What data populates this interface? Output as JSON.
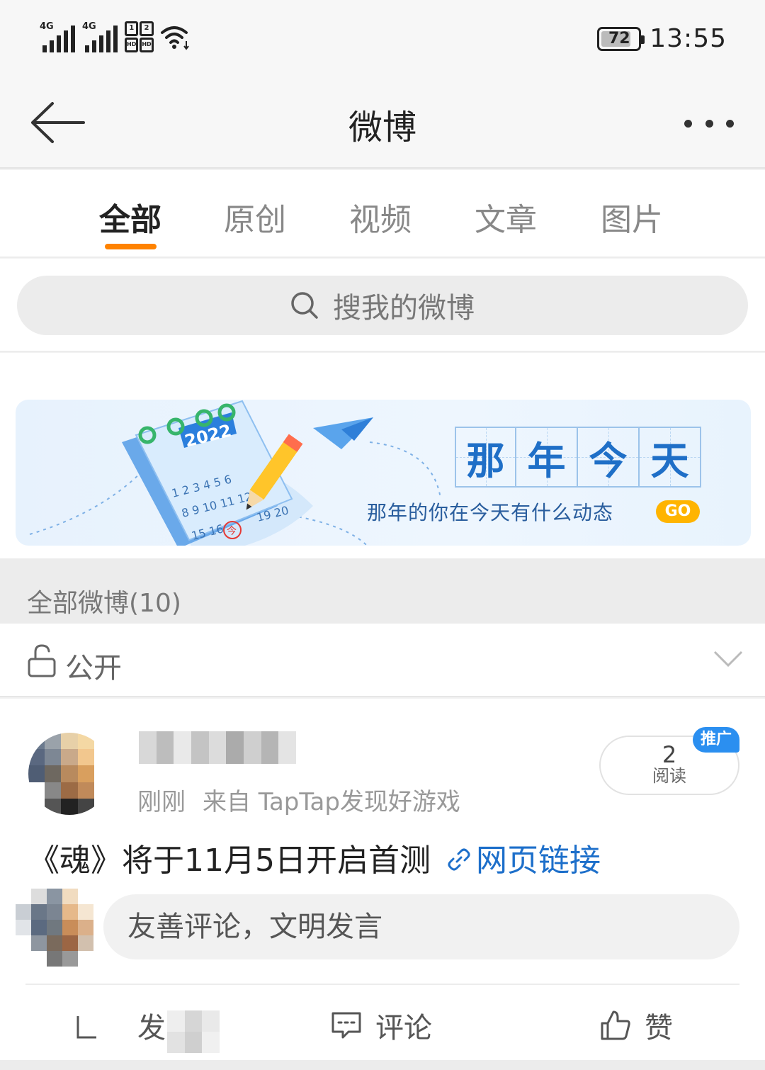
{
  "status_bar": {
    "signal_1": "4G",
    "signal_2": "4G",
    "hd_labels": [
      "1",
      "2",
      "HD",
      "HD"
    ],
    "battery": "72",
    "time": "13:55"
  },
  "header": {
    "title": "微博",
    "back_icon": "arrow-left-icon",
    "more_icon": "more-dots-icon"
  },
  "tabs": [
    {
      "label": "全部",
      "active": true
    },
    {
      "label": "原创",
      "active": false
    },
    {
      "label": "视频",
      "active": false
    },
    {
      "label": "文章",
      "active": false
    },
    {
      "label": "图片",
      "active": false
    }
  ],
  "search": {
    "placeholder": "搜我的微博",
    "icon": "search-icon"
  },
  "banner": {
    "calendar_year": "2022",
    "calendar_days": [
      "1 2 3 4 5 6",
      "8 9 10 11 12",
      "15 16",
      "19 20"
    ],
    "today_mark": "今",
    "title_chars": [
      "那",
      "年",
      "今",
      "天"
    ],
    "subtitle": "那年的你在今天有什么动态",
    "cta": "GO"
  },
  "section": {
    "header": "全部微博(10)"
  },
  "visibility": {
    "label": "公开",
    "icon": "unlock-icon"
  },
  "post": {
    "time": "刚刚",
    "source": "来自 TapTap发现好游戏",
    "reads_count": "2",
    "reads_label": "阅读",
    "promo_tag": "推广",
    "text": "《魂》将于11月5日开启首测",
    "link_label": "网页链接"
  },
  "comment": {
    "placeholder": "友善评论，文明发言"
  },
  "actions": {
    "repost": "转发",
    "repost_visible": "发",
    "comment": "评论",
    "like": "赞"
  },
  "colors": {
    "accent_orange": "#ff8200",
    "link_blue": "#1d6fca",
    "promo_blue": "#2b8ff0",
    "go_yellow": "#ffb400"
  }
}
